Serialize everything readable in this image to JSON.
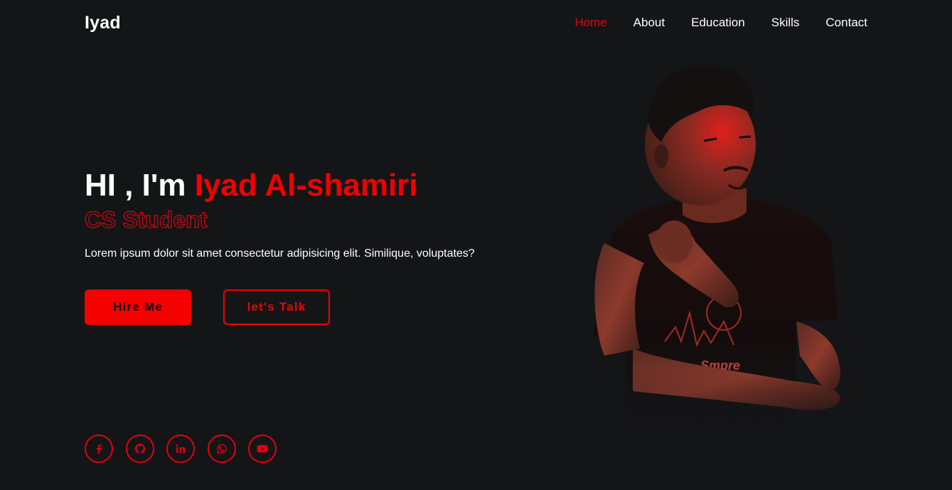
{
  "header": {
    "logo": "Iyad",
    "nav": [
      {
        "label": "Home",
        "active": true
      },
      {
        "label": "About",
        "active": false
      },
      {
        "label": "Education",
        "active": false
      },
      {
        "label": "Skills",
        "active": false
      },
      {
        "label": "Contact",
        "active": false
      }
    ]
  },
  "hero": {
    "greeting": "HI , I'm ",
    "name": "Iyad Al-shamiri",
    "role": "CS Student",
    "intro": "Lorem ipsum dolor sit amet consectetur adipisicing elit. Similique, voluptates?",
    "hire_label": "Hire Me",
    "talk_label": "let's Talk"
  },
  "socials": [
    {
      "icon": "facebook-icon"
    },
    {
      "icon": "github-icon"
    },
    {
      "icon": "linkedin-icon"
    },
    {
      "icon": "whatsapp-icon"
    },
    {
      "icon": "youtube-icon"
    }
  ],
  "colors": {
    "background": "#141517",
    "accent": "#f00000",
    "text": "#ffffff"
  },
  "portrait": {
    "shirt_text": "Smpre"
  }
}
